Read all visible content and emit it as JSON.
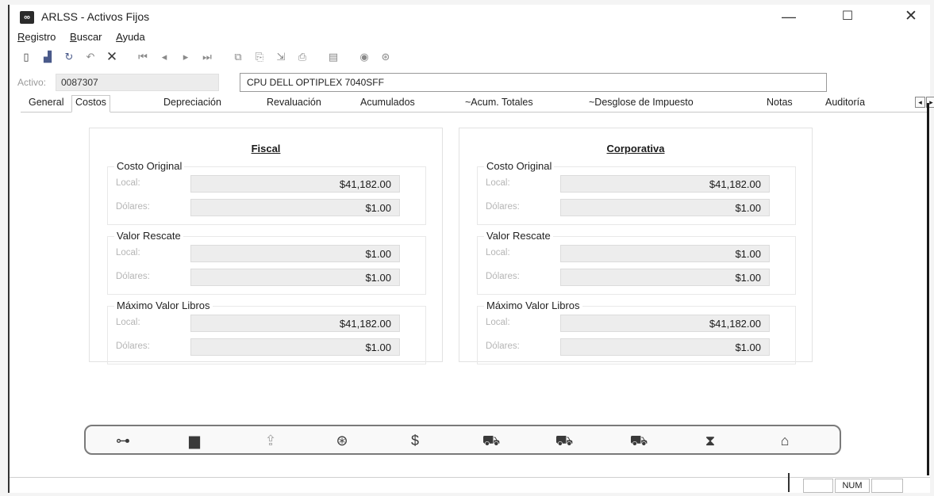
{
  "window": {
    "title": "ARLSS - Activos Fijos",
    "app_icon": "ARLSS-logo-icon"
  },
  "menu": [
    {
      "underline": "R",
      "rest": "egistro"
    },
    {
      "underline": "B",
      "rest": "uscar"
    },
    {
      "underline": "A",
      "rest": "yuda"
    }
  ],
  "toolbar_icons": [
    "new-document-icon",
    "save-icon",
    "open-icon",
    "undo-icon",
    "delete-x-icon",
    "first-record-icon",
    "previous-record-icon",
    "next-record-icon",
    "last-record-icon",
    "copy-icon",
    "paste-icon",
    "export-icon",
    "print-icon",
    "report-icon",
    "help-icon",
    "exit-icon"
  ],
  "activo": {
    "label": "Activo:",
    "code": "0087307",
    "description": "CPU DELL OPTIPLEX 7040SFF"
  },
  "tabs": [
    "General",
    "Costos",
    "Depreciación",
    "Revaluación",
    "Acumulados",
    "~Acum. Totales",
    "~Desglose de Impuesto",
    "Notas",
    "Auditoría"
  ],
  "active_tab": "Costos",
  "panels": {
    "fiscal": {
      "title": "Fiscal",
      "groups": [
        {
          "title": "Costo Original",
          "local_label": "Local:",
          "local": "$41,182.00",
          "usd_label": "Dólares:",
          "usd": "$1.00"
        },
        {
          "title": "Valor Rescate",
          "local_label": "Local:",
          "local": "$1.00",
          "usd_label": "Dólares:",
          "usd": "$1.00"
        },
        {
          "title": "Máximo Valor Libros",
          "local_label": "Local:",
          "local": "$41,182.00",
          "usd_label": "Dólares:",
          "usd": "$1.00"
        }
      ]
    },
    "corporativa": {
      "title": "Corporativa",
      "groups": [
        {
          "title": "Costo Original",
          "local_label": "Local:",
          "local": "$41,182.00",
          "usd_label": "Dólares:",
          "usd": "$1.00"
        },
        {
          "title": "Valor Rescate",
          "local_label": "Local:",
          "local": "$1.00",
          "usd_label": "Dólares:",
          "usd": "$1.00"
        },
        {
          "title": "Máximo Valor Libros",
          "local_label": "Local:",
          "local": "$41,182.00",
          "usd_label": "Dólares:",
          "usd": "$1.00"
        }
      ]
    }
  },
  "action_icons": [
    "org-chart-icon",
    "bar-chart-icon",
    "transfer-document-icon",
    "calendar-36-icon",
    "money-hand-icon",
    "truck-icon",
    "truck-down-icon",
    "truck-arrow-icon",
    "hourglass-icon",
    "bank-icon"
  ],
  "status": {
    "num": "NUM"
  }
}
